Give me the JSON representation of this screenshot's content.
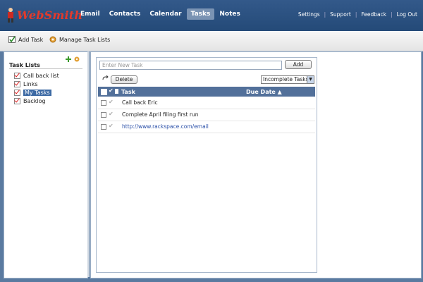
{
  "app": {
    "logo_text": "WebSmith"
  },
  "nav": [
    {
      "label": "Email"
    },
    {
      "label": "Contacts"
    },
    {
      "label": "Calendar"
    },
    {
      "label": "Tasks",
      "active": true
    },
    {
      "label": "Notes"
    }
  ],
  "util_links": {
    "settings": "Settings",
    "support": "Support",
    "feedback": "Feedback",
    "logout": "Log Out"
  },
  "toolbar": {
    "add_task": "Add Task",
    "manage_lists": "Manage Task Lists"
  },
  "sidebar": {
    "title": "Task Lists",
    "items": [
      {
        "label": "Call back list"
      },
      {
        "label": "Links"
      },
      {
        "label": "My Tasks",
        "selected": true
      },
      {
        "label": "Backlog"
      }
    ]
  },
  "tasks": {
    "new_task_placeholder": "Enter New Task",
    "add_label": "Add",
    "delete_label": "Delete",
    "filter_value": "Incomplete Tasks",
    "col_task": "Task",
    "col_due": "Due Date",
    "rows": [
      {
        "text": "Call back Eric"
      },
      {
        "text": "Complete April filing first run"
      },
      {
        "text": "http://www.rackspace.com/email"
      }
    ]
  },
  "colors": {
    "header": "#2b5182",
    "accent": "#e33a2b",
    "table_head": "#52709a",
    "link": "#2a4fa8"
  }
}
